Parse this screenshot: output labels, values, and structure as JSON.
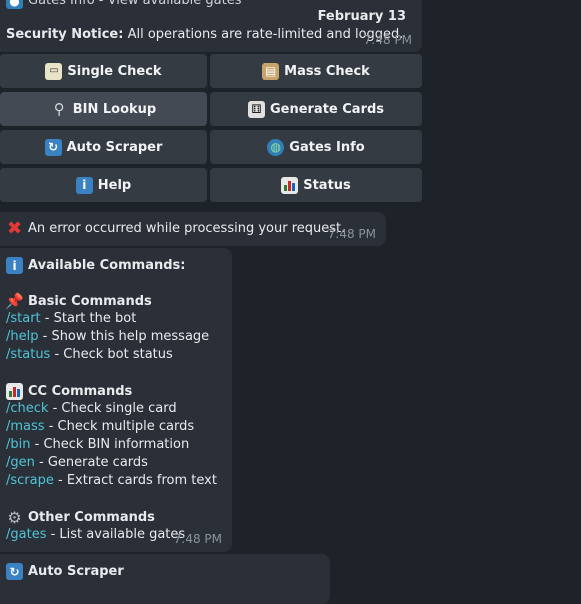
{
  "top_message": {
    "header_partial": "Gates Info - View available gates",
    "date": "February 13",
    "notice_label": "Security Notice:",
    "notice_text": "All operations are rate-limited and logged.",
    "time": "7:48 PM"
  },
  "keyboard": {
    "buttons": [
      {
        "label": "Single Check",
        "icon": "card-icon"
      },
      {
        "label": "Mass Check",
        "icon": "clipboard-icon"
      },
      {
        "label": "BIN Lookup",
        "icon": "magnifier-icon"
      },
      {
        "label": "Generate Cards",
        "icon": "dice-icon"
      },
      {
        "label": "Auto Scraper",
        "icon": "refresh-icon"
      },
      {
        "label": "Gates Info",
        "icon": "globe-icon"
      },
      {
        "label": "Help",
        "icon": "info-icon"
      },
      {
        "label": "Status",
        "icon": "bar-chart-icon"
      }
    ]
  },
  "error_message": {
    "text": "An error occurred while processing your request.",
    "time": "7:48 PM",
    "icon": "cross-icon"
  },
  "help_message": {
    "title": "Available Commands:",
    "sections": [
      {
        "heading": "Basic Commands",
        "icon": "pin-icon",
        "items": [
          {
            "cmd": "/start",
            "desc": " - Start the bot"
          },
          {
            "cmd": "/help",
            "desc": " - Show this help message"
          },
          {
            "cmd": "/status",
            "desc": " - Check bot status"
          }
        ]
      },
      {
        "heading": "CC Commands",
        "icon": "bar-chart-icon",
        "items": [
          {
            "cmd": "/check",
            "desc": " - Check single card"
          },
          {
            "cmd": "/mass",
            "desc": " - Check multiple cards"
          },
          {
            "cmd": "/bin",
            "desc": " - Check BIN information"
          },
          {
            "cmd": "/gen",
            "desc": " - Generate cards"
          },
          {
            "cmd": "/scrape",
            "desc": " - Extract cards from text"
          }
        ]
      },
      {
        "heading": "Other Commands",
        "icon": "gear-icon",
        "items": [
          {
            "cmd": "/gates",
            "desc": " - List available gates"
          }
        ]
      }
    ],
    "time": "7:48 PM"
  },
  "bottom_message": {
    "title": "Auto Scraper",
    "icon": "refresh-icon"
  },
  "colors": {
    "background": "#1e2329",
    "bubble": "#2b3038",
    "button": "#353b43",
    "command_link": "#4fc3d6",
    "timestamp": "#8a939c"
  }
}
